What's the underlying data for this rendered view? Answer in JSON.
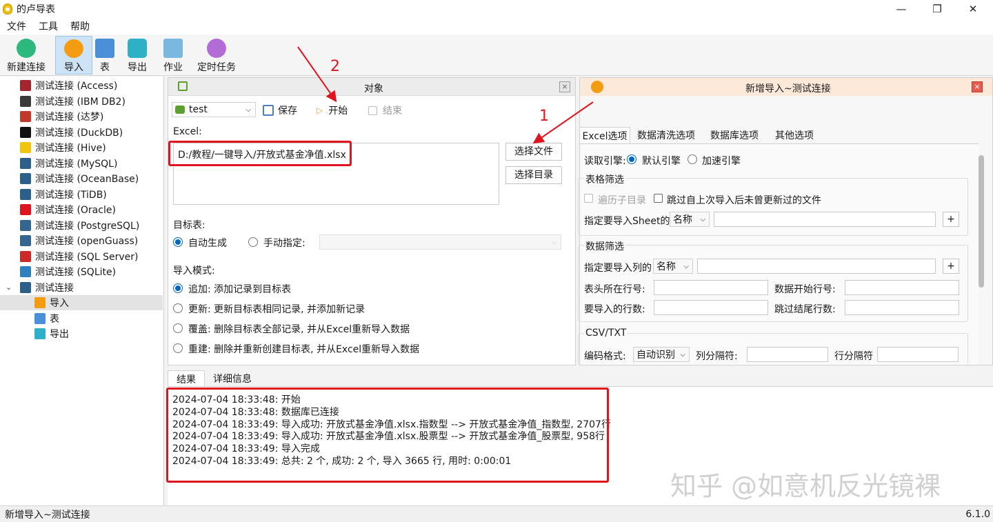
{
  "window": {
    "title": "的卢导表",
    "minimize": "—",
    "maximize": "❐",
    "close": "✕"
  },
  "menu": [
    "文件",
    "工具",
    "帮助"
  ],
  "toolbar": [
    {
      "label": "新建连接",
      "color": "#2db87d"
    },
    {
      "label": "导入",
      "color": "#f39c12"
    },
    {
      "label": "表",
      "color": "#4a90d9"
    },
    {
      "label": "导出",
      "color": "#2eb0c7"
    },
    {
      "label": "作业",
      "color": "#7ab8e0"
    },
    {
      "label": "定时任务",
      "color": "#b36bd6"
    }
  ],
  "tree": [
    {
      "label": "测试连接 (Access)",
      "color": "#a4262c"
    },
    {
      "label": "测试连接 (IBM DB2)",
      "color": "#3a3a3a"
    },
    {
      "label": "测试连接 (达梦)",
      "color": "#c0392b"
    },
    {
      "label": "测试连接 (DuckDB)",
      "color": "#111111"
    },
    {
      "label": "测试连接 (Hive)",
      "color": "#f1c40f"
    },
    {
      "label": "测试连接 (MySQL)",
      "color": "#2c5f8a"
    },
    {
      "label": "测试连接 (OceanBase)",
      "color": "#2c5f8a"
    },
    {
      "label": "测试连接 (TiDB)",
      "color": "#2c5f8a"
    },
    {
      "label": "测试连接 (Oracle)",
      "color": "#e0141e"
    },
    {
      "label": "测试连接 (PostgreSQL)",
      "color": "#336791"
    },
    {
      "label": "测试连接 (openGuass)",
      "color": "#336791"
    },
    {
      "label": "测试连接 (SQL Server)",
      "color": "#cc2927"
    },
    {
      "label": "测试连接 (SQLite)",
      "color": "#2f7fc1"
    },
    {
      "label": "测试连接",
      "color": "#2c5f8a"
    }
  ],
  "tree_children": [
    {
      "label": "导入",
      "color": "#f39c12"
    },
    {
      "label": "表",
      "color": "#4a90d9"
    },
    {
      "label": "导出",
      "color": "#2eb0c7"
    }
  ],
  "object_panel": {
    "title": "对象",
    "connection": "test",
    "save": "保存",
    "start": "开始",
    "end": "结束",
    "excel_label": "Excel:",
    "excel_path": "D:/教程/一键导入/开放式基金净值.xlsx",
    "choose_file": "选择文件",
    "choose_dir": "选择目录",
    "target_label": "目标表:",
    "auto_gen": "自动生成",
    "manual": "手动指定:",
    "mode_label": "导入模式:",
    "modes": [
      "追加: 添加记录到目标表",
      "更新: 更新目标表相同记录, 并添加新记录",
      "覆盖: 删除目标表全部记录, 并从Excel重新导入数据",
      "重建: 删除并重新创建目标表, 并从Excel重新导入数据"
    ]
  },
  "import_dialog": {
    "title": "新增导入~测试连接",
    "tabs": [
      "Excel选项",
      "数据清洗选项",
      "数据库选项",
      "其他选项"
    ],
    "engine_label": "读取引擎:",
    "engine_default": "默认引擎",
    "engine_fast": "加速引擎",
    "table_filter": "表格筛选",
    "traverse_sub": "遍历子目录",
    "skip_unchanged": "跳过自上次导入后未曾更新过的文件",
    "sheet_label": "指定要导入Sheet的",
    "sheet_combo": "名称",
    "data_filter": "数据筛选",
    "column_label": "指定要导入列的",
    "column_combo": "名称",
    "header_row": "表头所在行号:",
    "data_start": "数据开始行号:",
    "rows_count": "要导入的行数:",
    "skip_tail": "跳过结尾行数:",
    "csv_group": "CSV/TXT",
    "encoding_label": "编码格式:",
    "encoding_value": "自动识别",
    "col_sep": "列分隔符:",
    "row_sep": "行分隔符",
    "plus": "+"
  },
  "result": {
    "tabs": [
      "结果",
      "详细信息"
    ],
    "log": [
      "2024-07-04 18:33:48: 开始",
      "2024-07-04 18:33:48: 数据库已连接",
      "2024-07-04 18:33:49: 导入成功: 开放式基金净值.xlsx.指数型 --> 开放式基金净值_指数型, 2707行",
      "2024-07-04 18:33:49: 导入成功: 开放式基金净值.xlsx.股票型 --> 开放式基金净值_股票型, 958行",
      "2024-07-04 18:33:49: 导入完成",
      "2024-07-04 18:33:49: 总共: 2 个, 成功: 2 个, 导入 3665 行, 用时: 0:00:01"
    ]
  },
  "status": {
    "left": "新增导入~测试连接",
    "version": "6.1.0"
  },
  "annotations": [
    "1",
    "2"
  ],
  "watermark": "知乎 @如意机反光镜裸"
}
